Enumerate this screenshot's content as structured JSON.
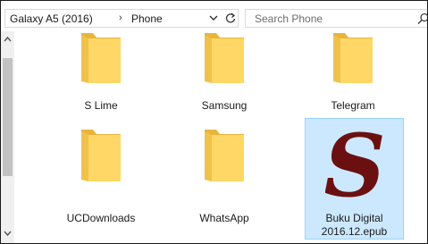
{
  "address": {
    "crumbs": [
      "Galaxy A5 (2016)",
      "Phone"
    ],
    "separator": "›"
  },
  "search": {
    "placeholder": "Search Phone"
  },
  "icons": {
    "folder": "folder-icon",
    "epub": "epub-book-icon",
    "dropdown": "chevron-down-icon",
    "refresh": "refresh-icon",
    "search": "search-icon"
  },
  "items": [
    {
      "label": "S Lime",
      "type": "folder"
    },
    {
      "label": "Samsung",
      "type": "folder"
    },
    {
      "label": "Telegram",
      "type": "folder"
    },
    {
      "label": "UCDownloads",
      "type": "folder"
    },
    {
      "label": "WhatsApp",
      "type": "folder"
    },
    {
      "label": "Buku Digital 2016.12.epub",
      "line1": "Buku Digital",
      "line2": "2016.12.epub",
      "type": "file",
      "selected": true
    }
  ],
  "colors": {
    "selection_bg": "#cce8ff",
    "selection_border": "#99d1ff",
    "folder_front": "#ffd766",
    "folder_back": "#e8b43c",
    "epub_letter": "#6b1010"
  }
}
